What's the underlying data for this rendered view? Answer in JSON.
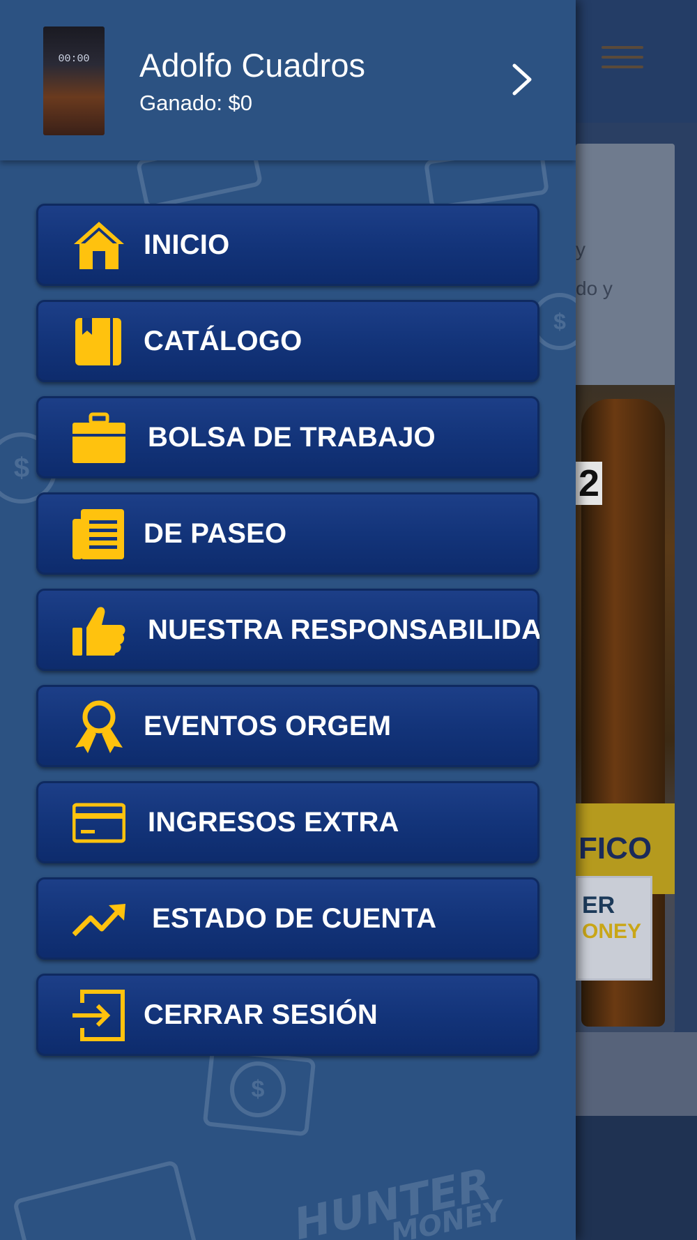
{
  "colors": {
    "drawer_background": "#2c5282",
    "menu_button_top": "#1d3f88",
    "menu_button_bottom": "#0d2b6c",
    "icon_accent": "#ffc20e",
    "text": "#ffffff"
  },
  "profile": {
    "avatar_icon": "phone-lockscreen-avatar",
    "avatar_time": "00:00",
    "name": "Adolfo Cuadros",
    "earned": "Ganado: $0"
  },
  "menu": {
    "items": [
      {
        "label": "INICIO",
        "icon": "home-icon"
      },
      {
        "label": "CATÁLOGO",
        "icon": "book-icon"
      },
      {
        "label": "BOLSA DE TRABAJO",
        "icon": "briefcase-icon"
      },
      {
        "label": "DE PASEO",
        "icon": "newspaper-icon"
      },
      {
        "label": "NUESTRA RESPONSABILIDA",
        "icon": "thumbs-up-icon"
      },
      {
        "label": "EVENTOS ORGEM",
        "icon": "award-icon"
      },
      {
        "label": "INGRESOS EXTRA",
        "icon": "credit-card-icon"
      },
      {
        "label": "ESTADO DE CUENTA",
        "icon": "trending-up-icon"
      },
      {
        "label": "CERRAR SESIÓN",
        "icon": "sign-out-icon"
      }
    ]
  },
  "background_app": {
    "card_text_1": "y",
    "card_text_2": "do y",
    "photo_number": "2",
    "label_text": "FICO",
    "logo_text_1": "ER",
    "logo_text_2": "ONEY"
  },
  "watermark": {
    "text_1": "HUNTER",
    "text_2": "MONEY"
  }
}
